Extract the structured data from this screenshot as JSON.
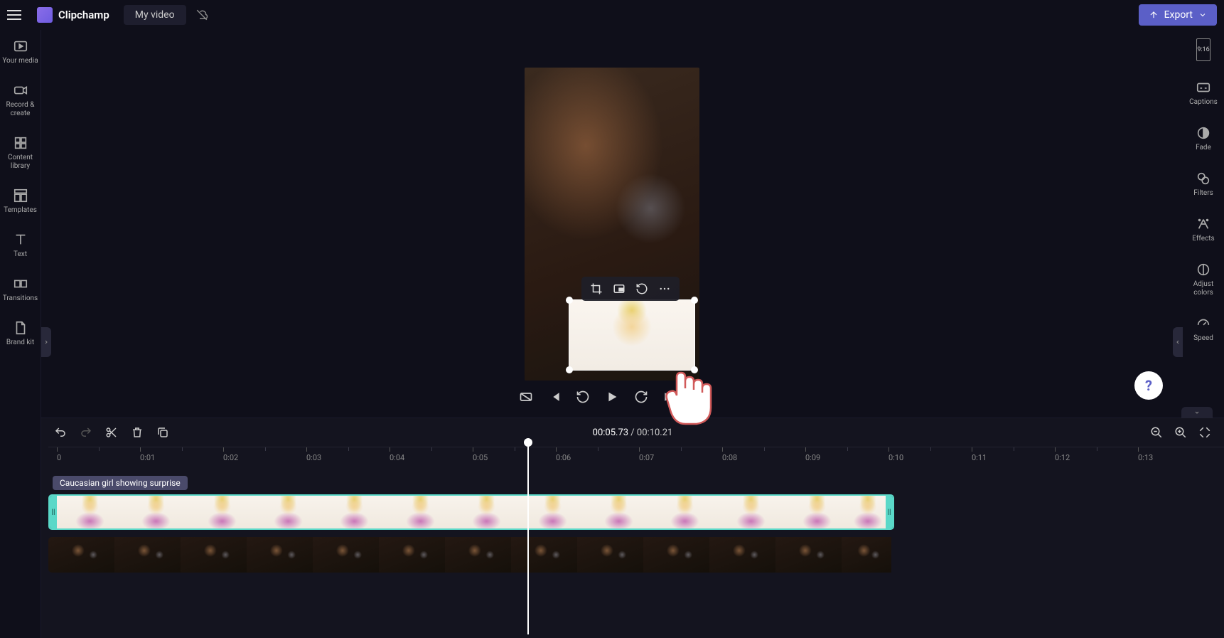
{
  "header": {
    "brand": "Clipchamp",
    "project_title": "My video",
    "export_label": "Export"
  },
  "left_sidebar": {
    "items": [
      {
        "label": "Your media"
      },
      {
        "label": "Record & create"
      },
      {
        "label": "Content library"
      },
      {
        "label": "Templates"
      },
      {
        "label": "Text"
      },
      {
        "label": "Transitions"
      },
      {
        "label": "Brand kit"
      }
    ]
  },
  "right_sidebar": {
    "aspect": "9:16",
    "items": [
      {
        "label": "Captions"
      },
      {
        "label": "Fade"
      },
      {
        "label": "Filters"
      },
      {
        "label": "Effects"
      },
      {
        "label": "Adjust colors"
      },
      {
        "label": "Speed"
      }
    ]
  },
  "playback": {
    "current_time": "00:05.73",
    "separator": " / ",
    "total_time": "00:10.21"
  },
  "ruler": {
    "ticks": [
      "0",
      "0:01",
      "0:02",
      "0:03",
      "0:04",
      "0:05",
      "0:06",
      "0:07",
      "0:08",
      "0:09",
      "0:10",
      "0:11",
      "0:12",
      "0:13"
    ]
  },
  "clip": {
    "label": "Caucasian girl showing surprise"
  },
  "help": {
    "label": "?"
  }
}
